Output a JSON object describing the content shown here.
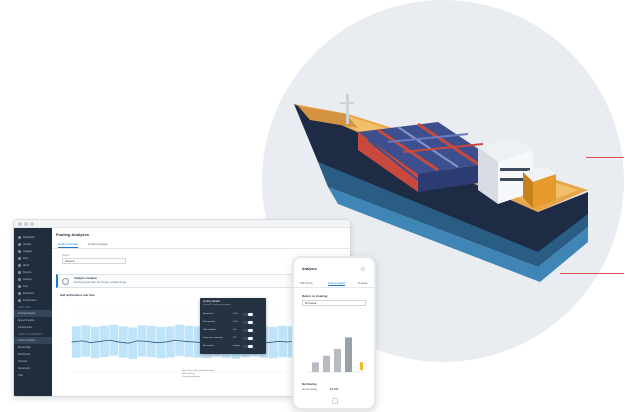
{
  "colors": {
    "accent": "#1b78c8",
    "sidebar": "#1f2d3d",
    "band": "#bfe3f8",
    "marker": "#e0334a",
    "bar": "#b8bcc2"
  },
  "app": {
    "page_title": "Fouling Analyses",
    "tabs": [
      "Fouling Overview",
      "Fouling Analyses"
    ],
    "field_label": "Vessel",
    "select_value": "Vessel A",
    "alert_title": "Analysis complete",
    "alert_sub": "Fouling analysis data, last 90 days, updated 1h ago",
    "chart_title": "Hull performance over time",
    "legend": [
      "Speed loss with confidence band",
      "Hull cleaning",
      "Propeller polishing"
    ]
  },
  "sidebar": {
    "items": [
      "Dashboard",
      "Vessels",
      "Voyages",
      "Fleet",
      "Alerts",
      "Reports",
      "Settings",
      "Fuel",
      "Emissions",
      "Performance"
    ],
    "section1": "ANALYSIS",
    "items2": [
      "Fouling Analysis",
      "Speed Analysis",
      "Consumption"
    ],
    "section2": "TOOLS & REPORTS",
    "items3": [
      "Custom Reports",
      "Export Data",
      "Benchmark",
      "Forecast",
      "Documents",
      "Help"
    ]
  },
  "tooltip": {
    "title": "Fouling details",
    "sub": "Vessel A · last measurement",
    "rows": [
      {
        "name": "Speed loss",
        "val": "4.2%"
      },
      {
        "name": "Fuel penalty",
        "val": "6.1%"
      },
      {
        "name": "Hull condition",
        "val": "Fair"
      },
      {
        "name": "Days since cleaning",
        "val": "212"
      },
      {
        "name": "Next action",
        "val": "Inspect"
      }
    ]
  },
  "phone": {
    "title": "Analyses",
    "close": "×",
    "tabs": [
      "Hull Fouling",
      "Fouling Analysis",
      "Propeller"
    ],
    "section": "Return on cleaning",
    "select_value": "All Vessels",
    "foot_title": "Net Saving",
    "foot_label": "Annual saving",
    "foot_value": "$1.8M"
  },
  "chart_data": [
    {
      "type": "area",
      "ylim": [
        0,
        10
      ],
      "x": [
        0,
        1,
        2,
        3,
        4,
        5,
        6,
        7,
        8,
        9,
        10,
        11,
        12,
        13,
        14,
        15,
        16,
        17,
        18,
        19,
        20,
        21,
        22,
        23,
        24,
        25,
        26,
        27,
        28,
        29
      ],
      "series": [
        {
          "values": [
            5.0,
            5.2,
            4.9,
            5.1,
            5.3,
            5.0,
            4.8,
            5.2,
            5.1,
            4.9,
            5.0,
            5.3,
            5.1,
            5.0,
            4.9,
            5.2,
            5.0,
            4.8,
            5.1,
            5.3,
            5.0,
            4.9,
            5.1,
            5.0,
            5.2,
            4.9,
            5.0,
            5.1,
            4.8,
            5.0
          ]
        }
      ]
    },
    {
      "type": "bar",
      "categories": [
        "A",
        "B",
        "C",
        "D"
      ],
      "values": [
        20,
        34,
        48,
        72
      ],
      "ylim": [
        0,
        100
      ]
    }
  ]
}
